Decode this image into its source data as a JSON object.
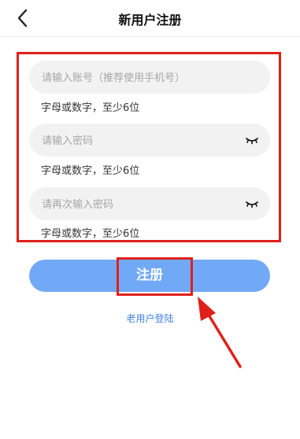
{
  "header": {
    "title": "新用户注册",
    "back_icon": "chevron-left-icon"
  },
  "form": {
    "account": {
      "placeholder": "请输入账号（推荐使用手机号）",
      "hint": "字母或数字，至少6位"
    },
    "password": {
      "placeholder": "请输入密码",
      "hint": "字母或数字，至少6位",
      "icon": "eye-closed-icon"
    },
    "confirm_password": {
      "placeholder": "请再次输入密码",
      "hint": "字母或数字，至少6位",
      "icon": "eye-closed-icon"
    }
  },
  "register_button": {
    "label": "注册"
  },
  "login_link": {
    "label": "老用户登陆"
  },
  "colors": {
    "annotation_red": "#e0201a",
    "button_blue": "#72a9f6",
    "link_blue": "#3f7fe6",
    "field_gray": "#f2f2f2"
  }
}
